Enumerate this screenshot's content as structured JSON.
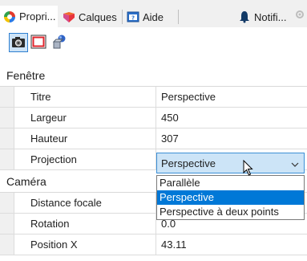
{
  "tabs": [
    {
      "label": "Propri...",
      "icon": "properties-icon"
    },
    {
      "label": "Calques",
      "icon": "layers-icon"
    },
    {
      "label": "Aide",
      "icon": "help-icon"
    },
    {
      "label": "Notifi...",
      "icon": "notifications-icon"
    }
  ],
  "toolbar": {
    "buttons": [
      "camera-icon",
      "frame-icon",
      "objects-icon"
    ]
  },
  "sections": {
    "window": {
      "title": "Fenêtre",
      "rows": [
        {
          "name": "Titre",
          "value": "Perspective"
        },
        {
          "name": "Largeur",
          "value": "450"
        },
        {
          "name": "Hauteur",
          "value": "307"
        },
        {
          "name": "Projection",
          "value": "Perspective"
        }
      ]
    },
    "camera": {
      "title": "Caméra",
      "rows": [
        {
          "name": "Distance focale",
          "value": ""
        },
        {
          "name": "Rotation",
          "value": "0.0"
        },
        {
          "name": "Position X",
          "value": "43.11"
        }
      ]
    }
  },
  "projection_dropdown": {
    "selected": "Perspective",
    "options": [
      "Parallèle",
      "Perspective",
      "Perspective à deux points"
    ]
  },
  "colors": {
    "accent": "#0078d7",
    "combo_bg": "#cce4f7",
    "tab_bg": "#f0f0f0"
  }
}
